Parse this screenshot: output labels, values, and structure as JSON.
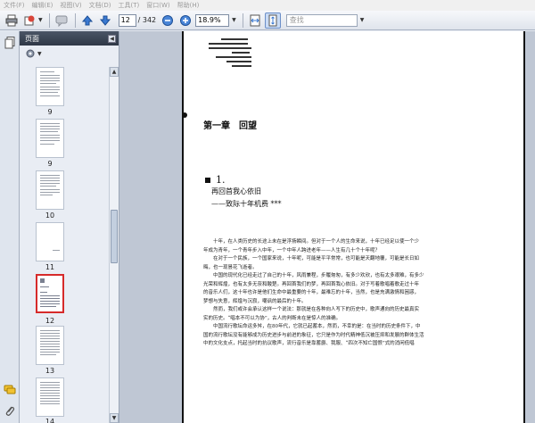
{
  "menu": [
    "文件(F)",
    "编辑(E)",
    "视图(V)",
    "文档(D)",
    "工具(T)",
    "窗口(W)",
    "帮助(H)"
  ],
  "toolbar": {
    "current_page": "12",
    "total_pages": "/ 342",
    "zoom": "18.9%",
    "search_placeholder": "查找"
  },
  "panel": {
    "title": "页面",
    "thumbnails": [
      {
        "label": "9"
      },
      {
        "label": "9"
      },
      {
        "label": "10"
      },
      {
        "label": "11"
      },
      {
        "label": "12",
        "selected": true
      },
      {
        "label": "13"
      },
      {
        "label": "14"
      }
    ]
  },
  "document": {
    "chapter_title": "第一章　回望",
    "section_title": "1.",
    "subtitle1": "再回首我心依旧",
    "subtitle2": "——致际十年机费 ***",
    "paragraphs": [
      "十年，在人类历史的长途上未在是浮扬瞬间。但对于一个人的生命来说，十年已经足以使一个少",
      "年成为青年，一个青年步入中年，一个中年人跨进老年——人生有几十个十年呢？",
      "在对于一个民族，一个国家来说，十年呢，可能是平平常常，也可能是天翻地覆，可能是长日如",
      "晦，也一现昙花飞逝者。",
      "中国的现代化已经走过了自己的十年，风雨兼程，步履匆匆，有多少欢欣，也有太多艰难，有多少",
      "光荣和辉煌，也有太多无奈和酸楚。再回首我们的梦，再回首我心依旧。对于写着歌唱着歌走过十年",
      "的音乐人们，这十年也许是他们生命中最重要的十年，最难忘的十年，当然，也是充满激情和困惑，",
      "梦想与失意，辉煌与沉寂，嘲讽的最后的十年。",
      "然而，我们或许会承认这样一个说法：那就是在各种向人写下的历史中，歌声通向的历史最真实",
      "实的历史。“唱本不可以为协”，古人的判断未在是惊人的准确。",
      "中国流行歌坛命运多舛，在80年代，它就已起蓄本，然而，不幸的是：在当时的历史条件下，中",
      "国的流行歌坛没有能够成为历史进步与前进的象征，它只是作为时代精神低沉被压抑和发展的群体生活",
      "中的文化支点，托起当时的抗议歌声，流行音乐是靠蓄爵、我服、“四次不知亡国恨”式的消闲低唱"
    ]
  }
}
